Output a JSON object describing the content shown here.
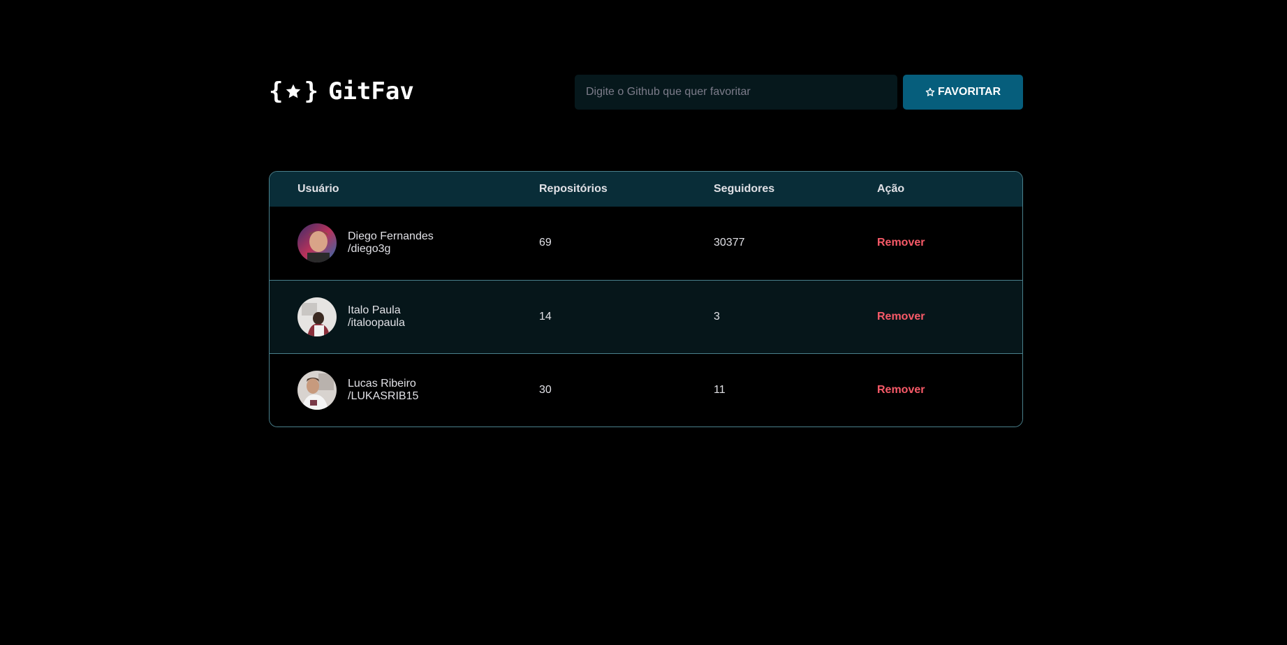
{
  "header": {
    "logo_text": "GitFav",
    "search": {
      "placeholder": "Digite o Github que quer favoritar",
      "value": ""
    },
    "favorite_button_label": "FAVORITAR"
  },
  "table": {
    "columns": [
      "Usuário",
      "Repositórios",
      "Seguidores",
      "Ação"
    ],
    "rows": [
      {
        "name": "Diego Fernandes",
        "login": "/diego3g",
        "repositories": "69",
        "followers": "30377",
        "action": "Remover"
      },
      {
        "name": "Italo Paula",
        "login": "/italoopaula",
        "repositories": "14",
        "followers": "3",
        "action": "Remover"
      },
      {
        "name": "Lucas Ribeiro",
        "login": "/LUKASRIB15",
        "repositories": "30",
        "followers": "11",
        "action": "Remover"
      }
    ]
  },
  "colors": {
    "background": "#000000",
    "primary": "#065e7c",
    "table_header": "#092d38",
    "danger": "#f75a68",
    "border": "#4a808c"
  }
}
